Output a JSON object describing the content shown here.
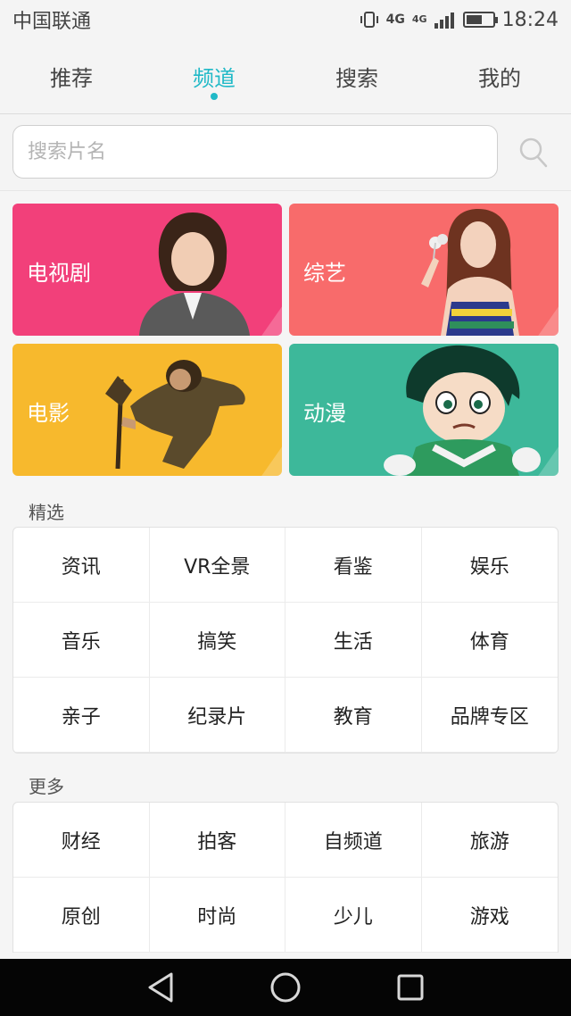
{
  "status": {
    "carrier": "中国联通",
    "network_1": "4G",
    "network_2": "4G",
    "time": "18:24",
    "battery_level": 0.6
  },
  "tabs": [
    {
      "label": "推荐",
      "active": false
    },
    {
      "label": "频道",
      "active": true
    },
    {
      "label": "搜索",
      "active": false
    },
    {
      "label": "我的",
      "active": false
    }
  ],
  "search": {
    "placeholder": "搜索片名",
    "value": ""
  },
  "categories": [
    {
      "label": "电视剧",
      "color": "#f2407a"
    },
    {
      "label": "综艺",
      "color": "#f86b6b"
    },
    {
      "label": "电影",
      "color": "#f7b92d"
    },
    {
      "label": "动漫",
      "color": "#3db89a"
    }
  ],
  "featured": {
    "title": "精选",
    "items": [
      "资讯",
      "VR全景",
      "看鉴",
      "娱乐",
      "音乐",
      "搞笑",
      "生活",
      "体育",
      "亲子",
      "纪录片",
      "教育",
      "品牌专区"
    ]
  },
  "more": {
    "title": "更多",
    "items": [
      "财经",
      "拍客",
      "自频道",
      "旅游",
      "原创",
      "时尚",
      "少儿",
      "游戏"
    ]
  },
  "colors": {
    "accent": "#20b9c7"
  }
}
